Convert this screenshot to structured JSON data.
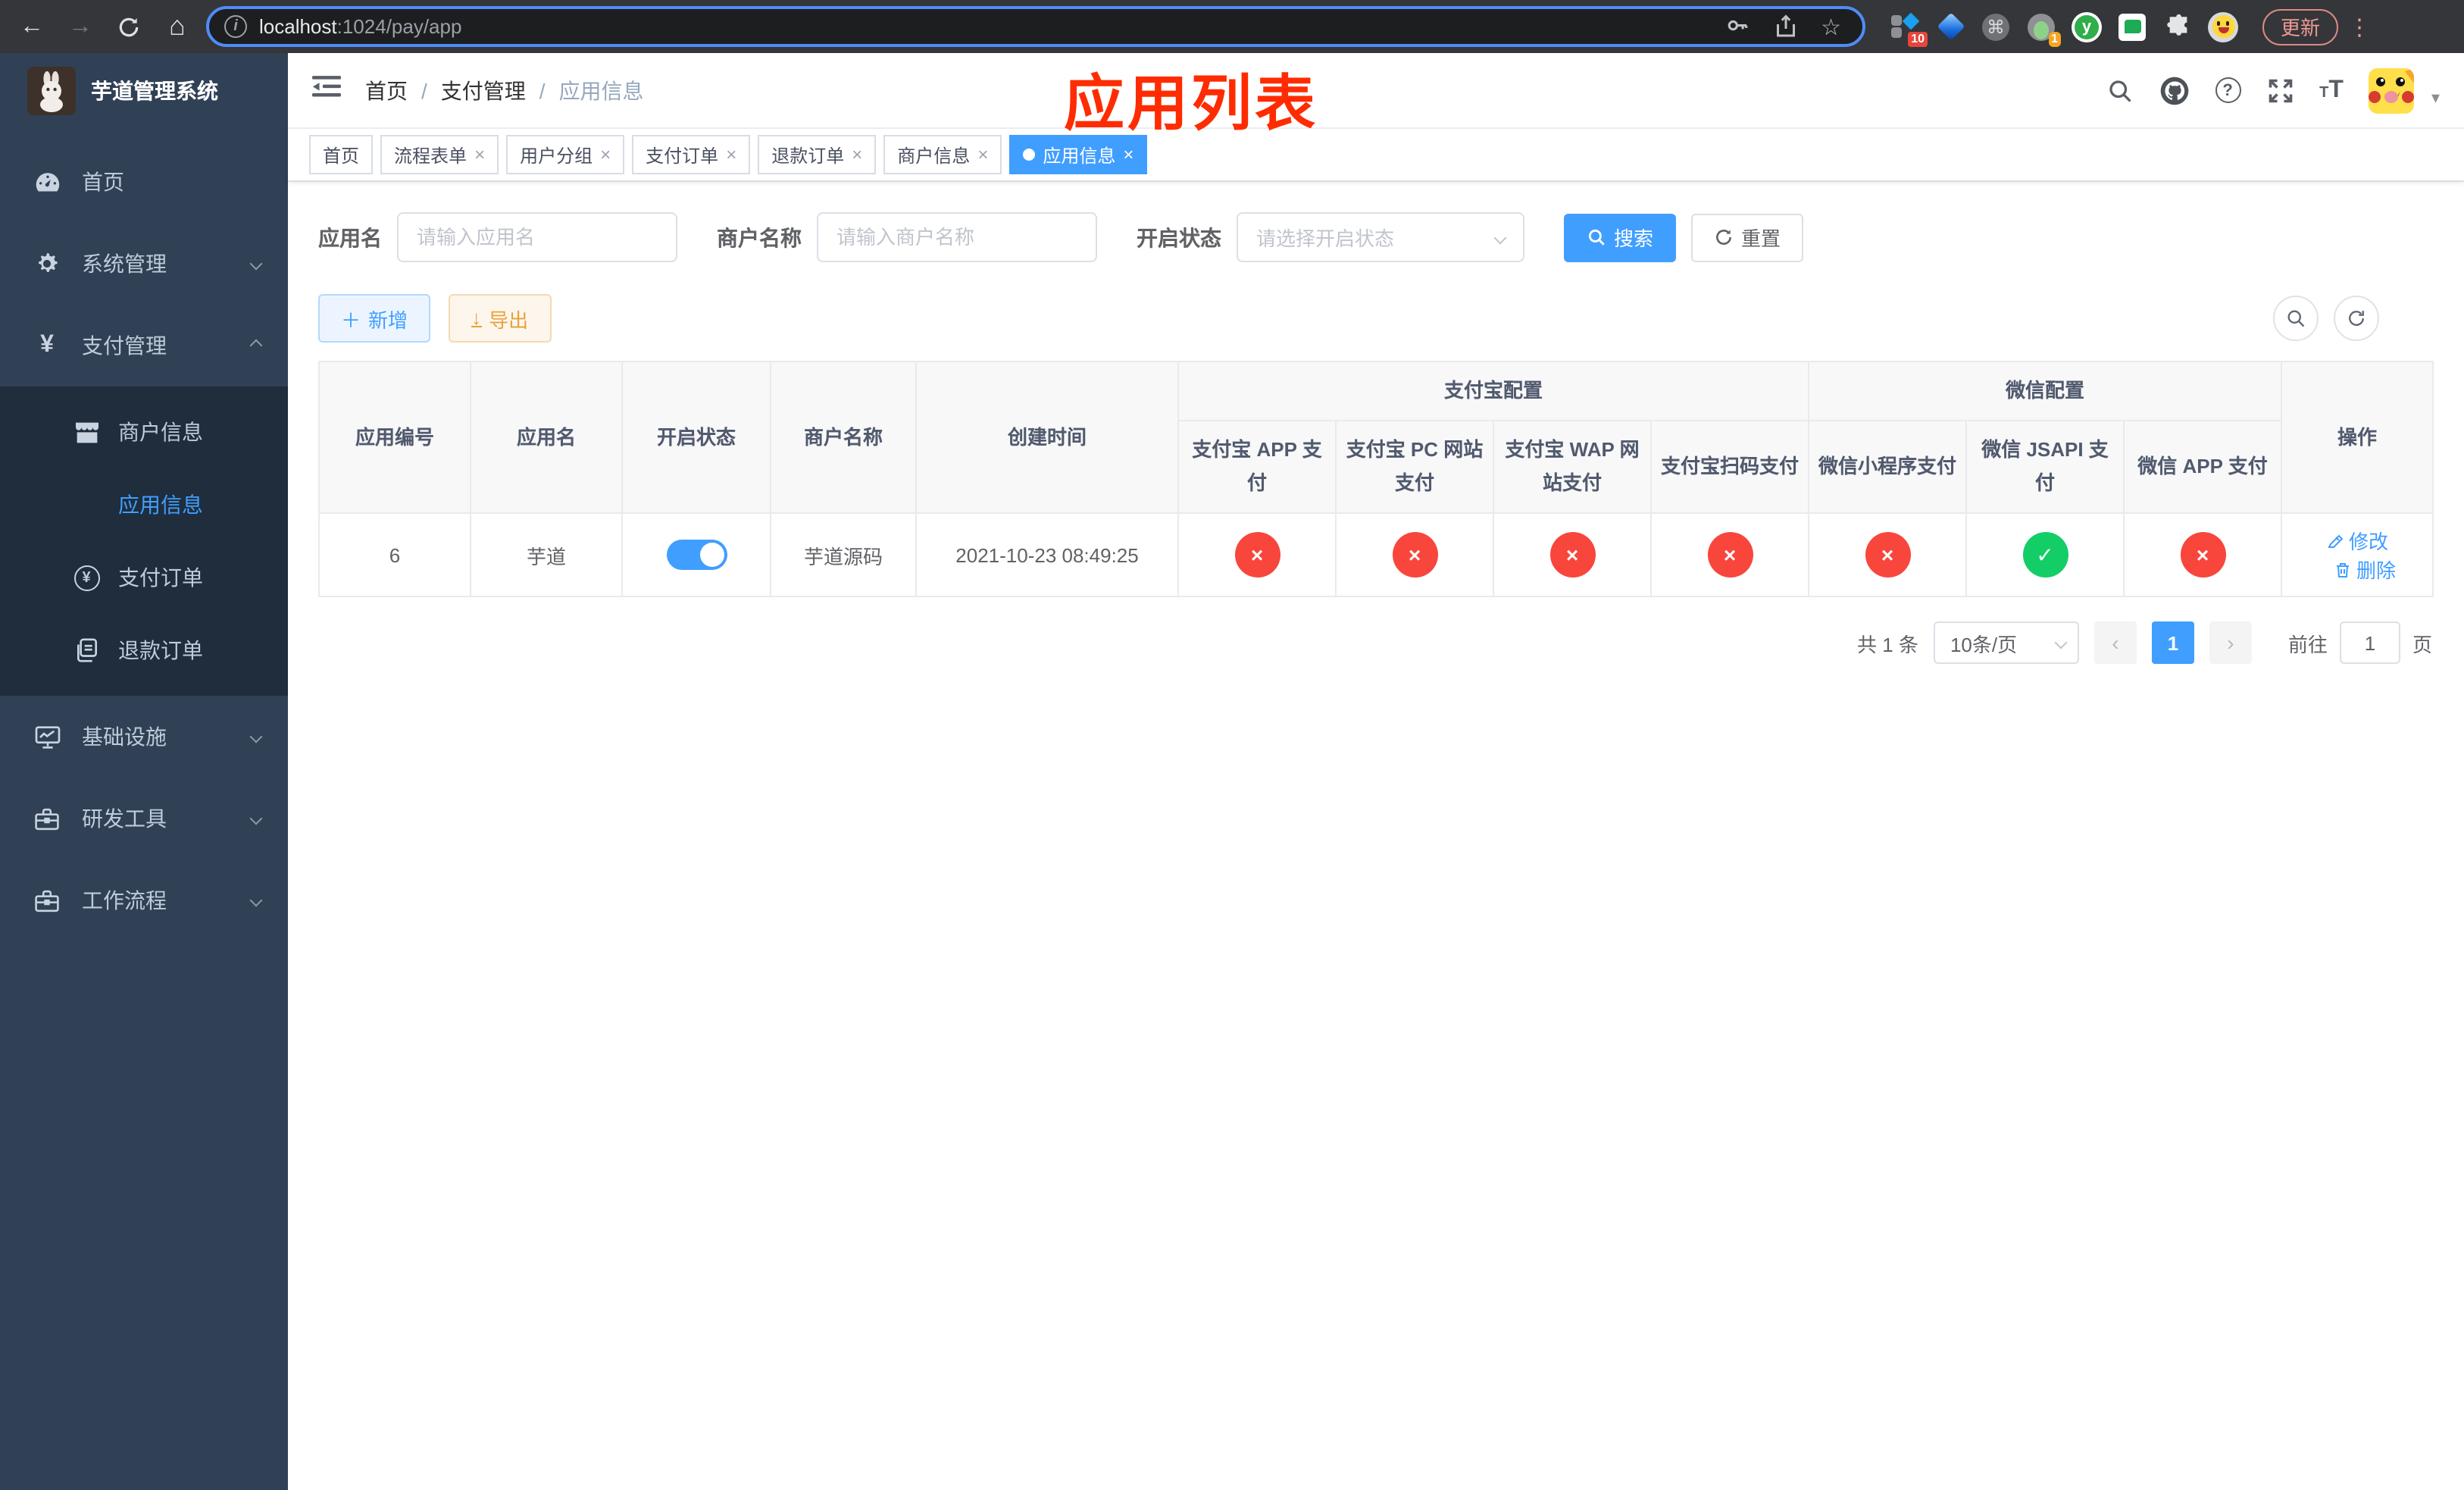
{
  "browser": {
    "url_host": "localhost",
    "url_path": ":1024/pay/app",
    "update_label": "更新",
    "ext_badge_grid": "10",
    "ext_badge_avatar": "1",
    "ext_y_letter": "y"
  },
  "icons": {
    "back": "←",
    "forward": "→",
    "home": "⌂",
    "star": "☆",
    "info": "i",
    "command": "⌘",
    "dots": "⋮",
    "close": "×",
    "check": "✓",
    "cross": "×",
    "prev": "‹",
    "next": "›",
    "plus": "＋",
    "download": "↓",
    "caret": "▾",
    "question": "?",
    "yen": "¥",
    "tsize_small": "T",
    "tsize_big": "T"
  },
  "colors": {
    "accent": "#409eff",
    "success": "#13ce66",
    "danger": "#f8463d",
    "warning": "#e6a23c",
    "sidebar_bg": "#304156",
    "sidebar_sub_bg": "#1f2d3d",
    "annotation_red": "#fe2c00",
    "chrome_update": "#ee9a92"
  },
  "sidebar": {
    "title": "芋道管理系统",
    "menu": [
      {
        "label": "首页"
      },
      {
        "label": "系统管理"
      },
      {
        "label": "支付管理"
      },
      {
        "label": "商户信息"
      },
      {
        "label": "应用信息"
      },
      {
        "label": "支付订单"
      },
      {
        "label": "退款订单"
      },
      {
        "label": "基础设施"
      },
      {
        "label": "研发工具"
      },
      {
        "label": "工作流程"
      }
    ]
  },
  "header": {
    "breadcrumb": [
      "首页",
      "支付管理",
      "应用信息"
    ],
    "annotation": "应用列表"
  },
  "tabs": [
    {
      "label": "首页"
    },
    {
      "label": "流程表单"
    },
    {
      "label": "用户分组"
    },
    {
      "label": "支付订单"
    },
    {
      "label": "退款订单"
    },
    {
      "label": "商户信息"
    },
    {
      "label": "应用信息"
    }
  ],
  "filters": {
    "app_name_label": "应用名",
    "app_name_placeholder": "请输入应用名",
    "merchant_label": "商户名称",
    "merchant_placeholder": "请输入商户名称",
    "status_label": "开启状态",
    "status_placeholder": "请选择开启状态",
    "search_label": "搜索",
    "reset_label": "重置"
  },
  "toolbar": {
    "add_label": "新增",
    "export_label": "导出"
  },
  "table": {
    "single_columns": [
      "应用编号",
      "应用名",
      "开启状态",
      "商户名称",
      "创建时间"
    ],
    "groups": {
      "alipay": "支付宝配置",
      "wechat": "微信配置"
    },
    "pay_columns": [
      "支付宝 APP 支付",
      "支付宝 PC 网站支付",
      "支付宝 WAP 网站支付",
      "支付宝扫码支付",
      "微信小程序支付",
      "微信 JSAPI 支付",
      "微信 APP 支付"
    ],
    "action_column": "操作",
    "row": {
      "id": "6",
      "name": "芋道",
      "enabled": true,
      "merchant": "芋道源码",
      "created": "2021-10-23 08:49:25",
      "statuses": [
        "fail",
        "fail",
        "fail",
        "fail",
        "fail",
        "success",
        "fail"
      ],
      "edit_label": "修改",
      "delete_label": "删除"
    }
  },
  "pagination": {
    "total": "共 1 条",
    "page_size": "10条/页",
    "current_page": "1",
    "goto_label": "前往",
    "goto_value": "1",
    "page_unit": "页"
  }
}
